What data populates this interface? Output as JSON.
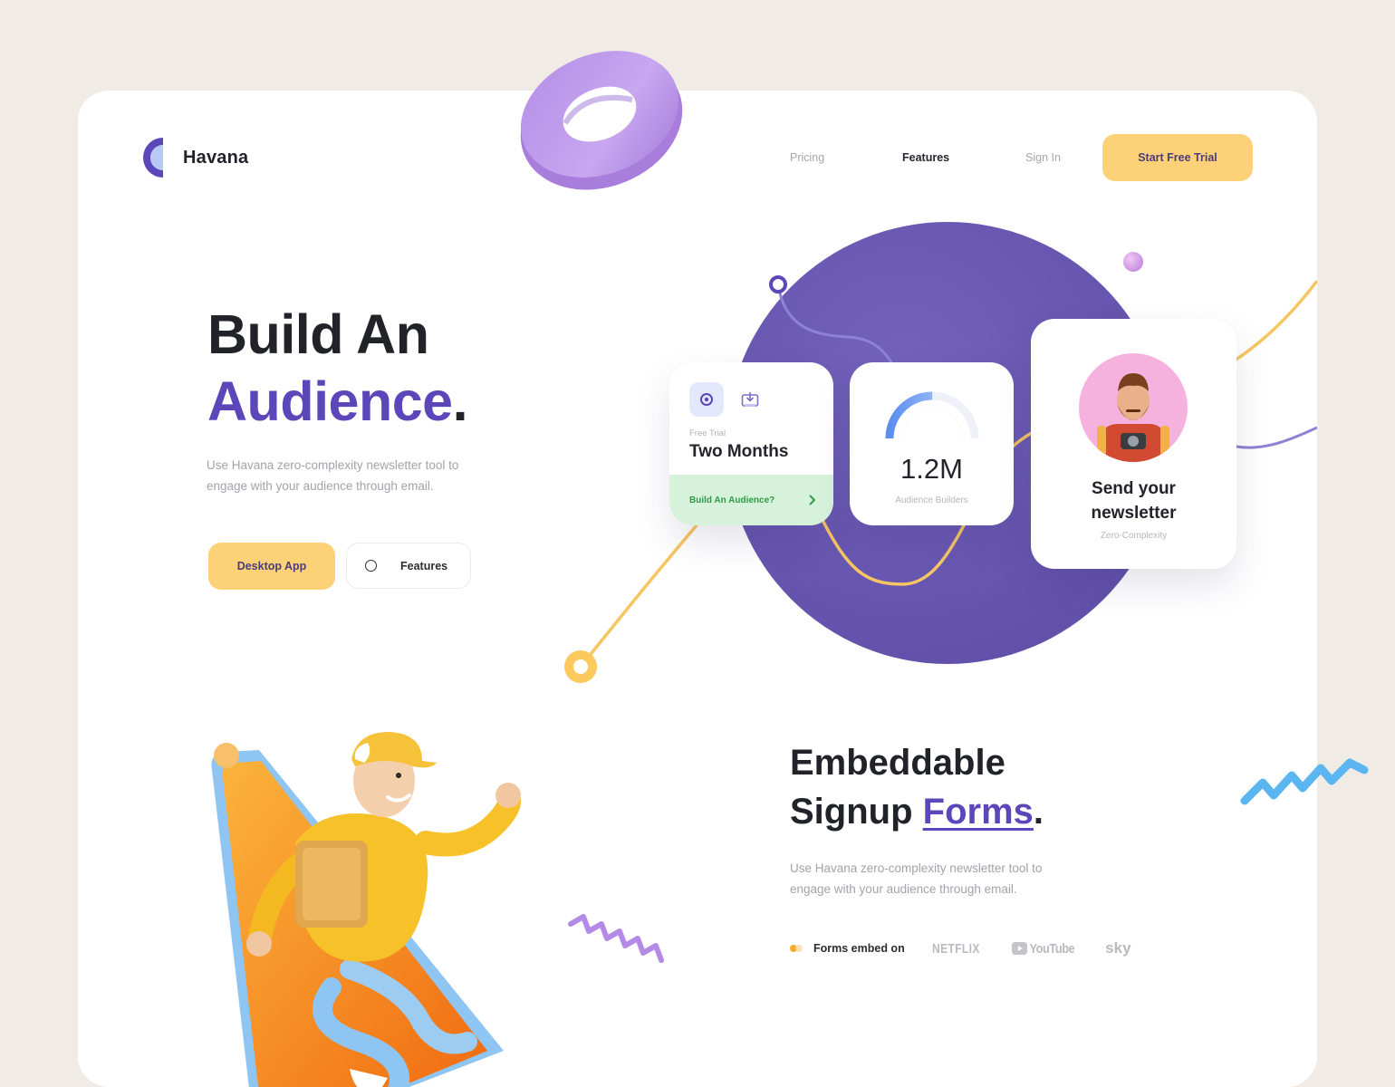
{
  "brand": {
    "name": "Havana"
  },
  "nav": {
    "items": [
      {
        "label": "Pricing",
        "active": false
      },
      {
        "label": "Features",
        "active": true
      },
      {
        "label": "Sign In",
        "active": false
      }
    ],
    "cta": "Start Free Trial"
  },
  "hero": {
    "title_line1": "Build An",
    "title_accent": "Audience",
    "title_end": ".",
    "description": "Use Havana zero-complexity newsletter tool to engage with your audience through email.",
    "primary_button": "Desktop App",
    "secondary_button": "Features"
  },
  "widgets": {
    "trial": {
      "label": "Free Trial",
      "value": "Two Months",
      "footer": "Build An Audience?"
    },
    "audience": {
      "value": "1.2M",
      "label": "Audience Builders",
      "gauge_fraction": 0.5
    },
    "newsletter": {
      "title_line1": "Send your",
      "title_line2": "newsletter",
      "subtitle": "Zero-Complexity"
    }
  },
  "section2": {
    "title_line1": "Embeddable",
    "title_line2_prefix": "Signup ",
    "title_link": "Forms",
    "title_end": ".",
    "description": "Use Havana zero-complexity newsletter tool to engage with your audience through email.",
    "embed_label": "Forms embed on",
    "brands": [
      "NETFLIX",
      "YouTube",
      "sky"
    ]
  },
  "colors": {
    "background": "#f1ebe6",
    "accent_purple": "#5b47b9",
    "circle_purple": "#6c5bb0",
    "button_yellow": "#fdd177",
    "success_green": "#2f9a48"
  },
  "icons": [
    "logo-mark-icon",
    "target-icon",
    "download-icon",
    "chevron-right-icon",
    "circle-outline-icon",
    "youtube-play-icon"
  ]
}
